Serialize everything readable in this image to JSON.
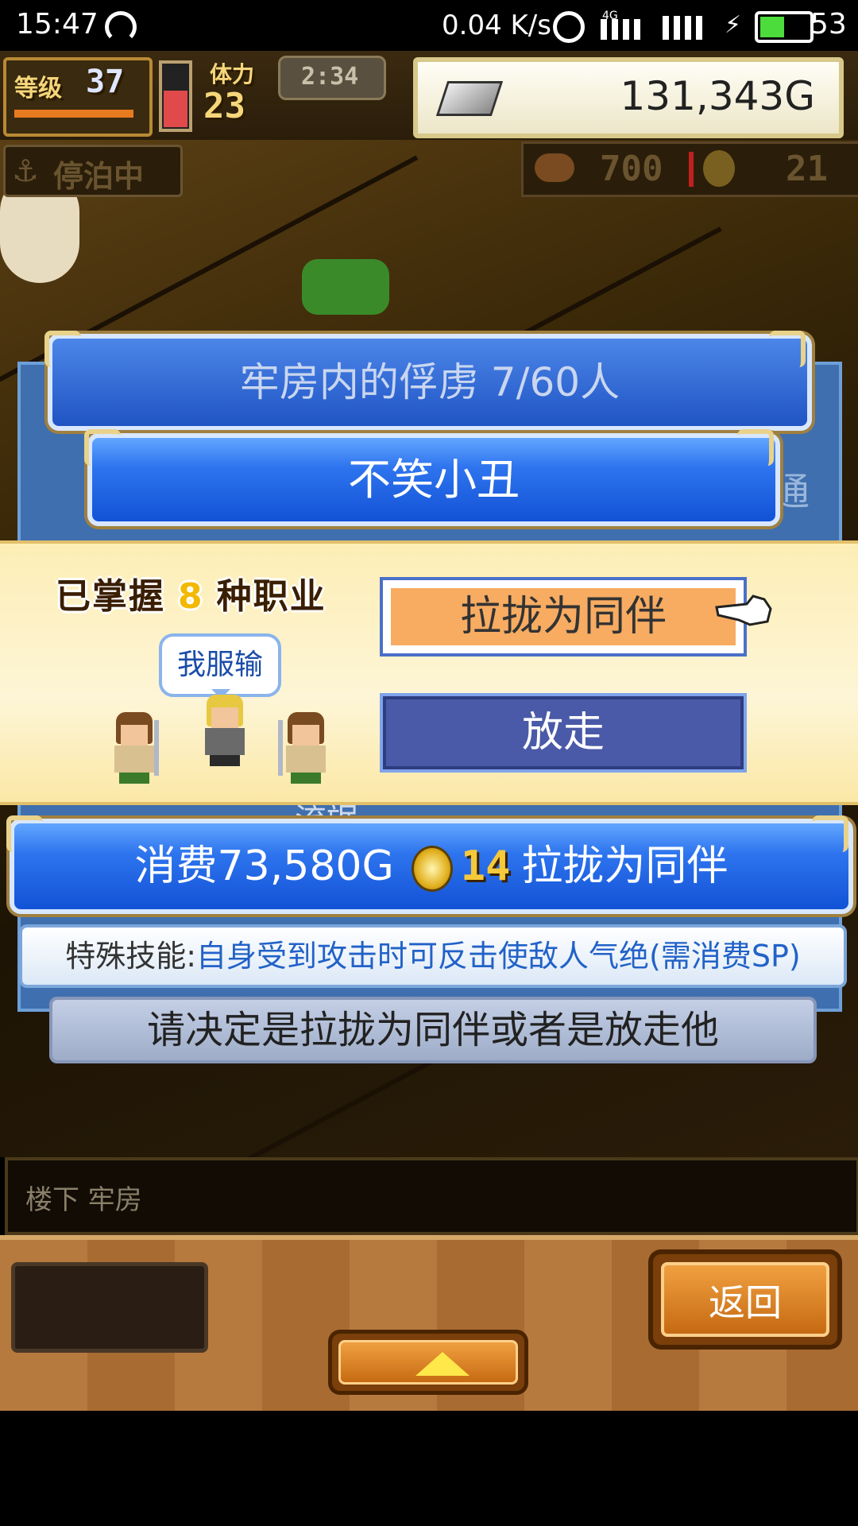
{
  "status_bar": {
    "time": "15:47",
    "net_speed": "0.04 K/s",
    "network": "4G",
    "battery": "53",
    "icons": [
      "hotspot-icon",
      "alarm-icon",
      "signal-icon",
      "charging-icon",
      "battery-icon"
    ]
  },
  "hud": {
    "level_label": "等级",
    "level": "37",
    "stamina_label": "体力",
    "stamina": "23",
    "timer": "2:34",
    "gold": "131,343G",
    "docked_label": "停泊中",
    "food": "700",
    "coins": "21"
  },
  "panel": {
    "title": "牢房内的俘虏  7/60人",
    "captive_name": "不笑小丑",
    "partial_right": "通",
    "partial_bottom": "流氓"
  },
  "dialog": {
    "skill_prefix": "已掌握",
    "skill_count": "8",
    "skill_suffix": "种职业",
    "speech": "我服输",
    "recruit_label": "拉拢为同伴",
    "release_label": "放走"
  },
  "cost_bar": {
    "cost_text": "消费73,580G",
    "coin_count": "14",
    "action_text": "拉拢为同伴"
  },
  "special_skill": {
    "label": "特殊技能:",
    "description": "自身受到攻击时可反击使敌人气绝(需消费SP)"
  },
  "instruction": "请决定是拉拢为同伴或者是放走他",
  "location": "楼下 牢房",
  "bottom_bar": {
    "back_label": "返回"
  }
}
